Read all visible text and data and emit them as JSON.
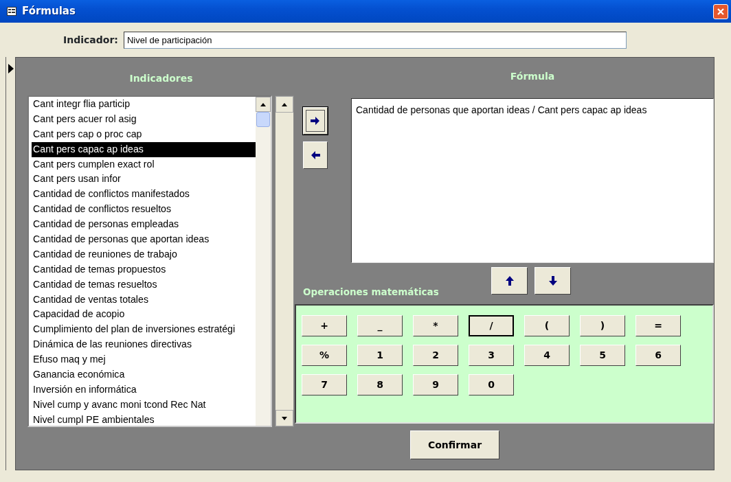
{
  "window": {
    "title": "Fórmulas"
  },
  "indicator": {
    "label": "Indicador:",
    "value": "Nivel de participación"
  },
  "indicators": {
    "heading": "Indicadores",
    "items": [
      {
        "label": "Cant integr flia particip",
        "selected": false
      },
      {
        "label": "Cant pers acuer rol asig",
        "selected": false
      },
      {
        "label": "Cant pers cap o proc cap",
        "selected": false
      },
      {
        "label": "Cant pers capac ap ideas",
        "selected": true
      },
      {
        "label": "Cant pers cumplen exact rol",
        "selected": false
      },
      {
        "label": "Cant pers usan infor",
        "selected": false
      },
      {
        "label": "Cantidad de conflictos manifestados",
        "selected": false
      },
      {
        "label": "Cantidad de conflictos resueltos",
        "selected": false
      },
      {
        "label": "Cantidad de personas empleadas",
        "selected": false
      },
      {
        "label": "Cantidad de personas que aportan ideas",
        "selected": false
      },
      {
        "label": "Cantidad de reuniones de trabajo",
        "selected": false
      },
      {
        "label": "Cantidad de temas propuestos",
        "selected": false
      },
      {
        "label": "Cantidad de temas resueltos",
        "selected": false
      },
      {
        "label": "Cantidad de ventas totales",
        "selected": false
      },
      {
        "label": "Capacidad de acopio",
        "selected": false
      },
      {
        "label": "Cumplimiento del plan de inversiones estratégi",
        "selected": false
      },
      {
        "label": "Dinámica de las reuniones directivas",
        "selected": false
      },
      {
        "label": "Efuso maq y mej",
        "selected": false
      },
      {
        "label": "Ganancia económica",
        "selected": false
      },
      {
        "label": "Inversión en informática",
        "selected": false
      },
      {
        "label": "Nivel cump y avanc moni tcond Rec Nat",
        "selected": false
      },
      {
        "label": "Nivel cumpl PE ambientales",
        "selected": false
      }
    ]
  },
  "formula": {
    "heading": "Fórmula",
    "value": "Cantidad de personas que aportan ideas / Cant pers capac ap ideas"
  },
  "move_buttons": [
    {
      "kind": "right",
      "focused": true
    },
    {
      "kind": "left",
      "focused": false
    }
  ],
  "order_buttons": [
    {
      "kind": "up"
    },
    {
      "kind": "down"
    }
  ],
  "operations": {
    "heading": "Operaciones matemáticas",
    "keys": [
      {
        "label": "+",
        "focused": false
      },
      {
        "label": "_",
        "focused": false
      },
      {
        "label": "*",
        "focused": false
      },
      {
        "label": "/",
        "focused": true
      },
      {
        "label": "(",
        "focused": false
      },
      {
        "label": ")",
        "focused": false
      },
      {
        "label": "=",
        "focused": false
      },
      {
        "label": "%",
        "focused": false
      },
      {
        "label": "1",
        "focused": false
      },
      {
        "label": "2",
        "focused": false
      },
      {
        "label": "3",
        "focused": false
      },
      {
        "label": "4",
        "focused": false
      },
      {
        "label": "5",
        "focused": false
      },
      {
        "label": "6",
        "focused": false
      },
      {
        "label": "7",
        "focused": false
      },
      {
        "label": "8",
        "focused": false
      },
      {
        "label": "9",
        "focused": false
      },
      {
        "label": "0",
        "focused": false
      }
    ]
  },
  "confirm_button": "Confirmar"
}
